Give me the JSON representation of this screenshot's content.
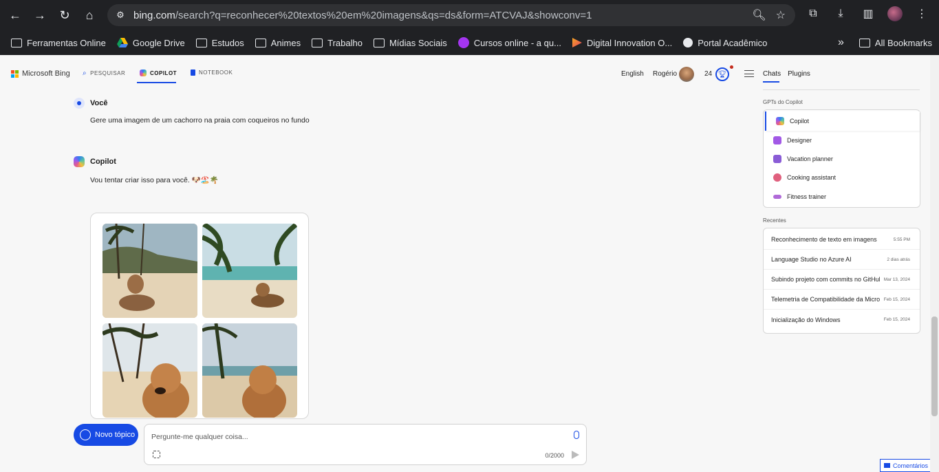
{
  "browser": {
    "url_host": "bing.com",
    "url_rest": "/search?q=reconhecer%20textos%20em%20imagens&qs=ds&form=ATCVAJ&showconv=1",
    "bookmarks": [
      {
        "label": "Ferramentas Online",
        "icon": "folder-icon"
      },
      {
        "label": "Google Drive",
        "icon": "google-drive-icon"
      },
      {
        "label": "Estudos",
        "icon": "folder-icon"
      },
      {
        "label": "Animes",
        "icon": "folder-icon"
      },
      {
        "label": "Trabalho",
        "icon": "folder-icon"
      },
      {
        "label": "Mídias Sociais",
        "icon": "folder-icon"
      },
      {
        "label": "Cursos online - a qu...",
        "icon": "udemy-icon"
      },
      {
        "label": "Digital Innovation O...",
        "icon": "dio-icon"
      },
      {
        "label": "Portal Acadêmico",
        "icon": "globe-icon"
      }
    ],
    "all_bookmarks": "All Bookmarks",
    "more_bookmarks": "»"
  },
  "header": {
    "brand": "Microsoft Bing",
    "tabs": [
      {
        "label": "PESQUISAR"
      },
      {
        "label": "COPILOT"
      },
      {
        "label": "NOTEBOOK"
      }
    ],
    "language": "English",
    "user_name": "Rogério",
    "points": "24",
    "side_tabs": [
      {
        "label": "Chats"
      },
      {
        "label": "Plugins"
      }
    ]
  },
  "chat": {
    "user_name": "Você",
    "user_message": "Gere uma imagem de um cachorro na praia com coqueiros no fundo",
    "bot_name": "Copilot",
    "bot_message": "Vou tentar criar isso para você. 🐶🏖️🌴"
  },
  "composer": {
    "new_topic": "Novo tópico",
    "placeholder": "Pergunte-me qualquer coisa...",
    "counter": "0/2000"
  },
  "sidebar": {
    "gpts_title": "GPTs do Copilot",
    "gpts": [
      {
        "label": "Copilot",
        "color": "#2f7ff0"
      },
      {
        "label": "Designer",
        "color": "#a259e6"
      },
      {
        "label": "Vacation planner",
        "color": "#8a5cd6"
      },
      {
        "label": "Cooking assistant",
        "color": "#e0607e"
      },
      {
        "label": "Fitness trainer",
        "color": "#b06ad8"
      }
    ],
    "recent_title": "Recentes",
    "recent": [
      {
        "title": "Reconhecimento de texto em imagens",
        "date": "5:55 PM"
      },
      {
        "title": "Language Studio no Azure AI",
        "date": "2 dias atrás"
      },
      {
        "title": "Subindo projeto com commits no GitHub",
        "date": "Mar 13, 2024"
      },
      {
        "title": "Telemetria de Compatibilidade da Microsoft",
        "date": "Feb 15, 2024"
      },
      {
        "title": "Inicialização do Windows",
        "date": "Feb 15, 2024"
      }
    ]
  },
  "feedback": "Comentários",
  "colors": {
    "accent": "#174ae4"
  }
}
